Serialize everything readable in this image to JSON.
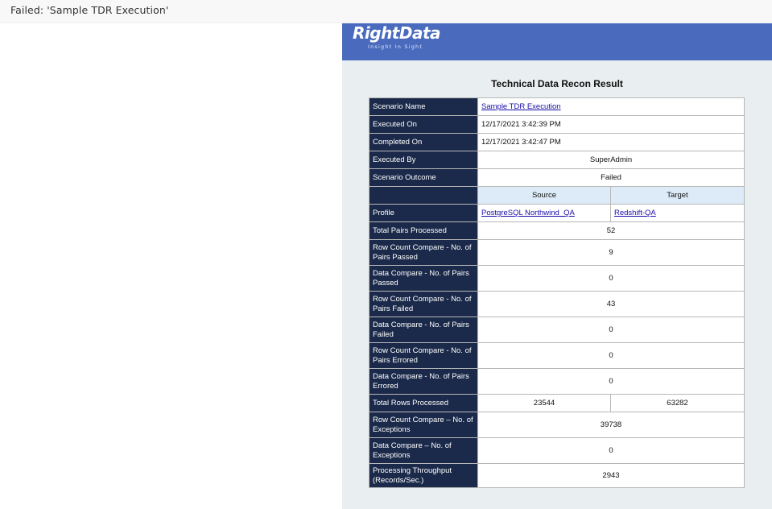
{
  "window": {
    "title": "Failed: 'Sample TDR Execution'"
  },
  "brand": {
    "logo": "RightData",
    "tagline": "Insight In Sight",
    "banner_color": "#4a6bbd"
  },
  "report": {
    "title": "Technical Data Recon Result",
    "scenario_name_label": "Scenario Name",
    "scenario_name": "Sample TDR Execution",
    "executed_on_label": "Executed On",
    "executed_on": "12/17/2021 3:42:39 PM",
    "completed_on_label": "Completed On",
    "completed_on": "12/17/2021 3:42:47 PM",
    "executed_by_label": "Executed By",
    "executed_by": "SuperAdmin",
    "outcome_label": "Scenario Outcome",
    "outcome": "Failed",
    "source_header": "Source",
    "target_header": "Target",
    "profile_label": "Profile",
    "profile_source": "PostgreSQL Northwind_QA",
    "profile_target": "Redshift-QA",
    "total_pairs_label": "Total Pairs Processed",
    "total_pairs": "52",
    "rc_passed_label": "Row Count Compare - No. of Pairs Passed",
    "rc_passed": "9",
    "dc_passed_label": "Data Compare - No. of Pairs Passed",
    "dc_passed": "0",
    "rc_failed_label": "Row Count Compare - No. of Pairs Failed",
    "rc_failed": "43",
    "dc_failed_label": "Data Compare - No. of Pairs Failed",
    "dc_failed": "0",
    "rc_errored_label": "Row Count Compare - No. of Pairs Errored",
    "rc_errored": "0",
    "dc_errored_label": "Data Compare - No. of Pairs Errored",
    "dc_errored": "0",
    "total_rows_label": "Total Rows Processed",
    "total_rows_source": "23544",
    "total_rows_target": "63282",
    "rc_exceptions_label": "Row Count Compare – No. of Exceptions",
    "rc_exceptions": "39738",
    "dc_exceptions_label": "Data Compare – No. of Exceptions",
    "dc_exceptions": "0",
    "throughput_label": "Processing Throughput (Records/Sec.)",
    "throughput": "2943"
  }
}
